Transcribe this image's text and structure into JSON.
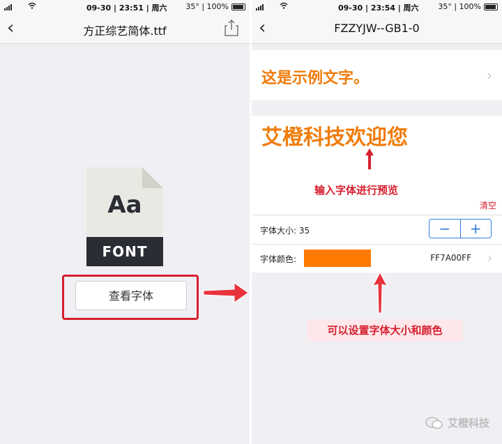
{
  "left_screen": {
    "status": {
      "time": "09-30 | 23:51 | 周六",
      "right": "35° | 100%"
    },
    "nav": {
      "title": "方正综艺简体.ttf"
    },
    "font_file": {
      "sample": "Aa",
      "label": "FONT"
    },
    "view_button_label": "查看字体"
  },
  "right_screen": {
    "status": {
      "time": "09-30 | 23:54 | 周六",
      "right": "35° | 100%"
    },
    "nav": {
      "title": "FZZYJW--GB1-0"
    },
    "sample_text": "这是示例文字。",
    "preview_text": "艾橙科技欢迎您",
    "annotation_preview": "输入字体进行预览",
    "clear_label": "清空",
    "font_size": {
      "label": "字体大小: 35",
      "minus": "−",
      "plus": "+"
    },
    "font_color": {
      "label": "字体颜色:",
      "hex": "FF7A00FF",
      "swatch": "#ff7a00"
    },
    "annotation_settings": "可以设置字体大小和颜色"
  },
  "watermark": "艾橙科技",
  "colors": {
    "accent_orange": "#f07c0a",
    "annotation_red": "#d6202f",
    "stepper_blue": "#2f7ce0"
  }
}
